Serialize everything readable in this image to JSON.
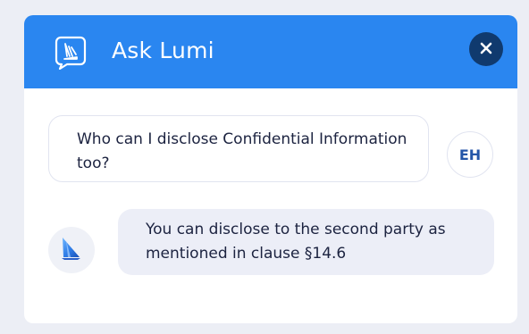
{
  "header": {
    "title": "Ask Lumi",
    "logo_icon": "lumi-chat-logo-icon",
    "close_icon": "close-icon"
  },
  "conversation": {
    "user_message": "Who can I disclose Confidential Information too?",
    "user_initials": "EH",
    "bot_message": "You can disclose to the second party as mentioned in clause §14.6",
    "bot_avatar_icon": "lumi-sail-icon"
  },
  "colors": {
    "header_bg": "#2A86F0",
    "close_button_bg": "#103A6E",
    "user_initials": "#2456A8",
    "bot_bubble_bg": "#ECEEF7",
    "page_bg": "#ECEEF5"
  }
}
